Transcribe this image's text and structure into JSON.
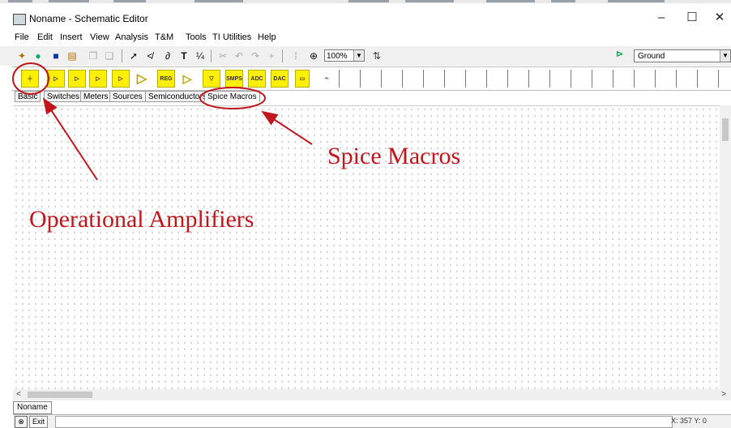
{
  "window": {
    "title": "Noname - Schematic Editor",
    "controls": {
      "minimize": "–",
      "maximize": "☐",
      "close": "✕"
    }
  },
  "menu": [
    "File",
    "Edit",
    "Insert",
    "View",
    "Analysis",
    "T&M",
    "Tools",
    "TI Utilities",
    "Help"
  ],
  "toolbar": {
    "zoom": "100%",
    "component_select": "Ground"
  },
  "palette": {
    "labels": [
      "REG",
      "SMPS",
      "ADC",
      "DAC",
      "DAC"
    ]
  },
  "tabs": [
    "Basic",
    "Switches",
    "Meters",
    "Sources",
    "Semiconductors",
    "Spice Macros"
  ],
  "annotations": {
    "spice_macros": "Spice Macros",
    "op_amps": "Operational Amplifiers"
  },
  "document_tab": "Noname",
  "status": {
    "exit": "Exit",
    "coords": "X: 357 Y: 0"
  },
  "colors": {
    "annotation": "#c0161c",
    "component_fill": "#ffef00"
  }
}
